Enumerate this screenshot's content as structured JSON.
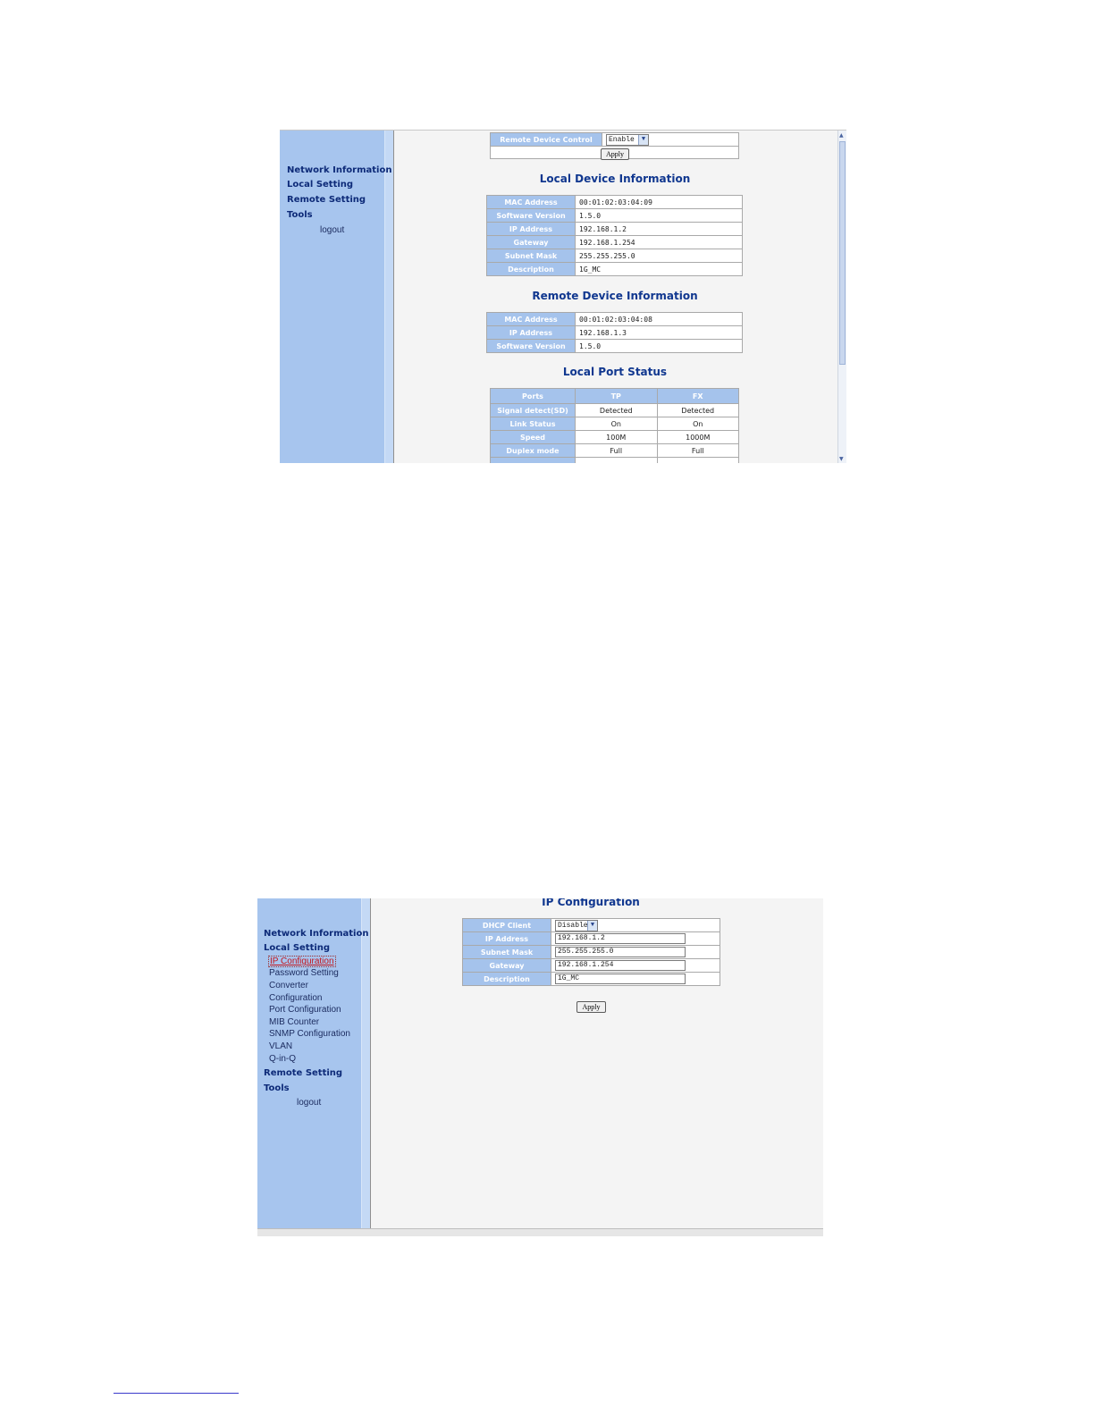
{
  "screen1": {
    "nav": {
      "network_information": "Network Information",
      "local_setting": "Local Setting",
      "remote_setting": "Remote Setting",
      "tools": "Tools",
      "logout": "logout"
    },
    "remote_control": {
      "label": "Remote Device Control",
      "value": "Enable",
      "apply": "Apply"
    },
    "local_device": {
      "title": "Local Device Information",
      "rows": [
        {
          "label": "MAC Address",
          "value": "00:01:02:03:04:09"
        },
        {
          "label": "Software Version",
          "value": "1.5.0"
        },
        {
          "label": "IP Address",
          "value": "192.168.1.2"
        },
        {
          "label": "Gateway",
          "value": "192.168.1.254"
        },
        {
          "label": "Subnet Mask",
          "value": "255.255.255.0"
        },
        {
          "label": "Description",
          "value": "1G_MC"
        }
      ]
    },
    "remote_device": {
      "title": "Remote Device Information",
      "rows": [
        {
          "label": "MAC Address",
          "value": "00:01:02:03:04:08"
        },
        {
          "label": "IP Address",
          "value": "192.168.1.3"
        },
        {
          "label": "Software Version",
          "value": "1.5.0"
        }
      ]
    },
    "port_status": {
      "title": "Local Port Status",
      "headers": [
        "Ports",
        "TP",
        "FX"
      ],
      "rows": [
        {
          "label": "Signal detect(SD)",
          "tp": "Detected",
          "fx": "Detected"
        },
        {
          "label": "Link Status",
          "tp": "On",
          "fx": "On"
        },
        {
          "label": "Speed",
          "tp": "100M",
          "fx": "1000M"
        },
        {
          "label": "Duplex mode",
          "tp": "Full",
          "fx": "Full"
        }
      ]
    }
  },
  "screen2": {
    "nav": {
      "network_information": "Network Information",
      "local_setting": "Local Setting",
      "sub_items": [
        "IP Configuration",
        "Password Setting",
        "Converter",
        "Configuration",
        "Port Configuration",
        "MIB Counter",
        "SNMP Configuration",
        "VLAN",
        "Q-in-Q"
      ],
      "remote_setting": "Remote Setting",
      "tools": "Tools",
      "logout": "logout"
    },
    "ip_config": {
      "title": "IP Configuration",
      "dhcp_label": "DHCP Client",
      "dhcp_value": "Disable",
      "rows": [
        {
          "label": "IP Address",
          "value": "192.168.1.2"
        },
        {
          "label": "Subnet Mask",
          "value": "255.255.255.0"
        },
        {
          "label": "Gateway",
          "value": "192.168.1.254"
        },
        {
          "label": "Description",
          "value": "1G_MC"
        }
      ],
      "apply": "Apply"
    }
  }
}
